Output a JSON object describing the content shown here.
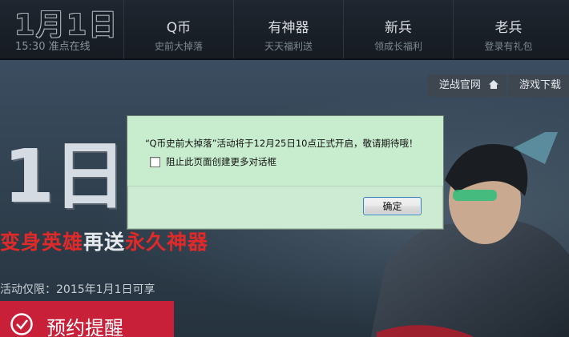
{
  "nav": {
    "brand": {
      "title": "1月1日",
      "subtitle": "15:30 准点在线"
    },
    "items": [
      {
        "title": "Q币",
        "sub": "史前大掉落"
      },
      {
        "title": "有神器",
        "sub": "天天福利送"
      },
      {
        "title": "新兵",
        "sub": "领成长福利"
      },
      {
        "title": "老兵",
        "sub": "登录有礼包"
      }
    ]
  },
  "hero": {
    "quick_links": {
      "official": "逆战官网",
      "download": "游戏下载"
    },
    "big_date": "1日1",
    "slogan": {
      "part1": "变身英雄",
      "part2": "再送",
      "part3": "永久神器"
    },
    "activity": "活动仅限：2015年1月1日可享",
    "reserve_label": "预约提醒",
    "colors": {
      "accent_red": "#e02a2a",
      "button_red": "#c9203a"
    }
  },
  "dialog": {
    "message": "“Q币史前大掉落”活动将于12月25日10点正式开启，敬请期待哦！",
    "checkbox_label": "阻止此页面创建更多对话框",
    "checkbox_checked": false,
    "ok_label": "确定"
  },
  "icons": [
    "home-icon",
    "check-circle-icon",
    "checkbox-icon"
  ]
}
